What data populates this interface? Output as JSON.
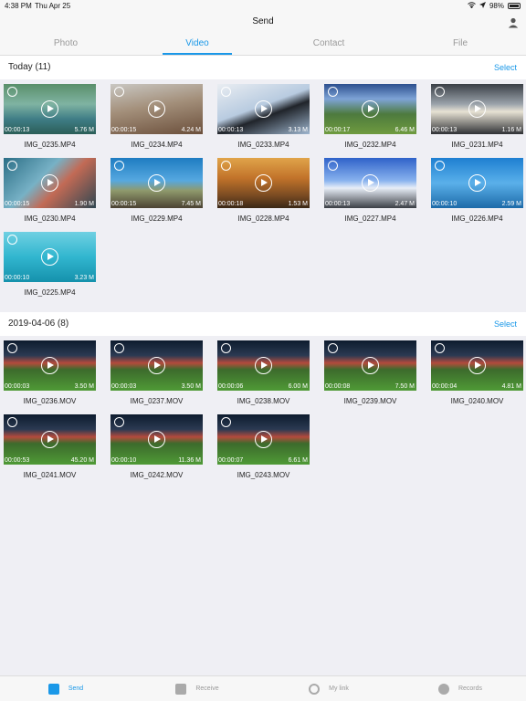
{
  "status": {
    "time": "4:38 PM",
    "date": "Thu Apr 25",
    "battery": "98%"
  },
  "nav": {
    "title": "Send"
  },
  "tabs": [
    "Photo",
    "Video",
    "Contact",
    "File"
  ],
  "active_tab": "Video",
  "sections": [
    {
      "label": "Today (11)",
      "select": "Select",
      "items": [
        {
          "name": "IMG_0235.MP4",
          "duration": "00:00:13",
          "size": "5.76 M"
        },
        {
          "name": "IMG_0234.MP4",
          "duration": "00:00:15",
          "size": "4.24 M"
        },
        {
          "name": "IMG_0233.MP4",
          "duration": "00:00:13",
          "size": "3.13 M"
        },
        {
          "name": "IMG_0232.MP4",
          "duration": "00:00:17",
          "size": "6.46 M"
        },
        {
          "name": "IMG_0231.MP4",
          "duration": "00:00:13",
          "size": "1.16 M"
        },
        {
          "name": "IMG_0230.MP4",
          "duration": "00:00:15",
          "size": "1.90 M"
        },
        {
          "name": "IMG_0229.MP4",
          "duration": "00:00:15",
          "size": "7.45 M"
        },
        {
          "name": "IMG_0228.MP4",
          "duration": "00:00:18",
          "size": "1.53 M"
        },
        {
          "name": "IMG_0227.MP4",
          "duration": "00:00:13",
          "size": "2.47 M"
        },
        {
          "name": "IMG_0226.MP4",
          "duration": "00:00:10",
          "size": "2.59 M"
        },
        {
          "name": "IMG_0225.MP4",
          "duration": "00:00:10",
          "size": "3.23 M"
        }
      ]
    },
    {
      "label": "2019-04-06 (8)",
      "select": "Select",
      "items": [
        {
          "name": "IMG_0236.MOV",
          "duration": "00:00:03",
          "size": "3.50 M"
        },
        {
          "name": "IMG_0237.MOV",
          "duration": "00:00:03",
          "size": "3.50 M"
        },
        {
          "name": "IMG_0238.MOV",
          "duration": "00:00:06",
          "size": "6.00 M"
        },
        {
          "name": "IMG_0239.MOV",
          "duration": "00:00:08",
          "size": "7.50 M"
        },
        {
          "name": "IMG_0240.MOV",
          "duration": "00:00:04",
          "size": "4.81 M"
        },
        {
          "name": "IMG_0241.MOV",
          "duration": "00:00:53",
          "size": "45.20 M"
        },
        {
          "name": "IMG_0242.MOV",
          "duration": "00:00:10",
          "size": "11.36 M"
        },
        {
          "name": "IMG_0243.MOV",
          "duration": "00:00:07",
          "size": "6.61 M"
        }
      ]
    }
  ],
  "bottom_tabs": [
    "Send",
    "Receive",
    "My link",
    "Records"
  ],
  "colors": {
    "accent": "#1a98e8"
  }
}
